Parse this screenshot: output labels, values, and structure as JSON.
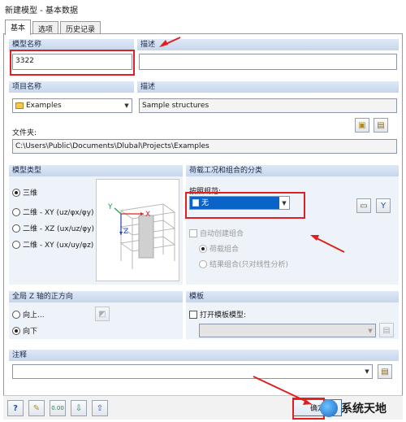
{
  "window": {
    "title": "新建模型 - 基本数据"
  },
  "tabs": [
    {
      "label": "基本",
      "active": true
    },
    {
      "label": "选项",
      "active": false
    },
    {
      "label": "历史记录",
      "active": false
    }
  ],
  "model": {
    "name_label": "模型名称",
    "name_value": "3322",
    "desc_label": "描述",
    "desc_value": ""
  },
  "project": {
    "name_label": "项目名称",
    "name_value": "Examples",
    "desc_label": "描述",
    "desc_value": "Sample structures",
    "folder_label": "文件夹:",
    "folder_value": "C:\\Users\\Public\\Documents\\Dlubal\\Projects\\Examples"
  },
  "model_type": {
    "header": "模型类型",
    "options": [
      {
        "label": "三维",
        "selected": true
      },
      {
        "label": "二维 - XY (uz/φx/φy)",
        "selected": false
      },
      {
        "label": "二维 - XZ (ux/uz/φy)",
        "selected": false
      },
      {
        "label": "二维 - XY (ux/uy/φz)",
        "selected": false
      }
    ],
    "axis_labels": {
      "x": "X",
      "y": "Y",
      "z": "Z"
    }
  },
  "loads": {
    "header": "荷载工况和组合的分类",
    "standard_label": "按照规范:",
    "standard_value": "无",
    "auto_label": "自动创建组合",
    "auto_options": [
      {
        "label": "荷载组合",
        "selected": true
      },
      {
        "label": "结果组合(只对线性分析)",
        "selected": false
      }
    ]
  },
  "z_axis": {
    "header": "全局 Z 轴的正方向",
    "options": [
      {
        "label": "向上...",
        "selected": false
      },
      {
        "label": "向下",
        "selected": true
      }
    ]
  },
  "template": {
    "header": "模板",
    "open_label": "打开模板模型:"
  },
  "comment": {
    "header": "注释",
    "value": ""
  },
  "footer": {
    "ok_label": "确定"
  },
  "watermark": {
    "text": "系统天地"
  },
  "colors": {
    "accent_red": "#e02020",
    "section_header": "#c6d6ec",
    "selection_blue": "#0a64c8"
  }
}
